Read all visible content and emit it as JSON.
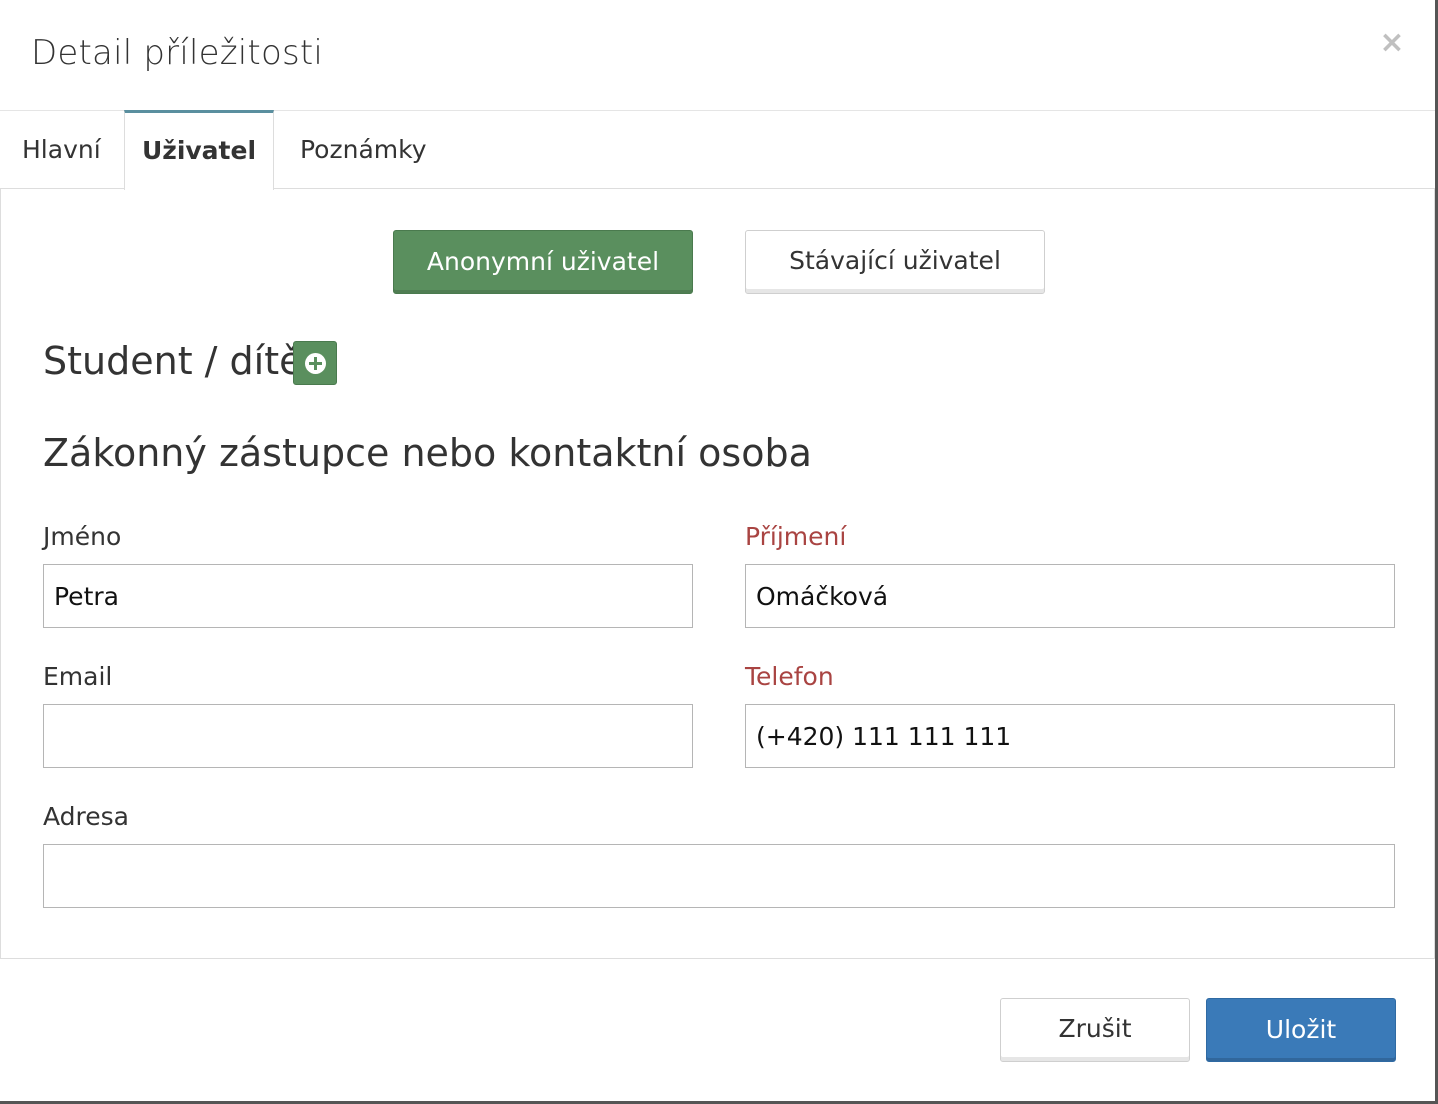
{
  "modal": {
    "title": "Detail příležitosti",
    "close_label": "×"
  },
  "tabs": [
    {
      "label": "Hlavní",
      "active": false
    },
    {
      "label": "Uživatel",
      "active": true
    },
    {
      "label": "Poznámky",
      "active": false
    }
  ],
  "user_type": {
    "anonymous_label": "Anonymní uživatel",
    "existing_label": "Stávající uživatel",
    "selected": "anonymous"
  },
  "student_heading": "Student / dítě",
  "contact_heading": "Zákonný zástupce nebo kontaktní osoba",
  "fields": {
    "first_name": {
      "label": "Jméno",
      "value": "Petra",
      "required": false
    },
    "last_name": {
      "label": "Příjmení",
      "value": "Omáčková",
      "required": true
    },
    "email": {
      "label": "Email",
      "value": "",
      "required": false
    },
    "phone": {
      "label": "Telefon",
      "value": "(+420) 111 111 111",
      "required": true
    },
    "address": {
      "label": "Adresa",
      "value": "",
      "required": false
    }
  },
  "footer": {
    "cancel_label": "Zrušit",
    "save_label": "Uložit"
  },
  "colors": {
    "success": "#5a8f5e",
    "primary": "#3a7ab8",
    "required_label": "#a94442",
    "active_tab_border": "#5a8f9f"
  }
}
